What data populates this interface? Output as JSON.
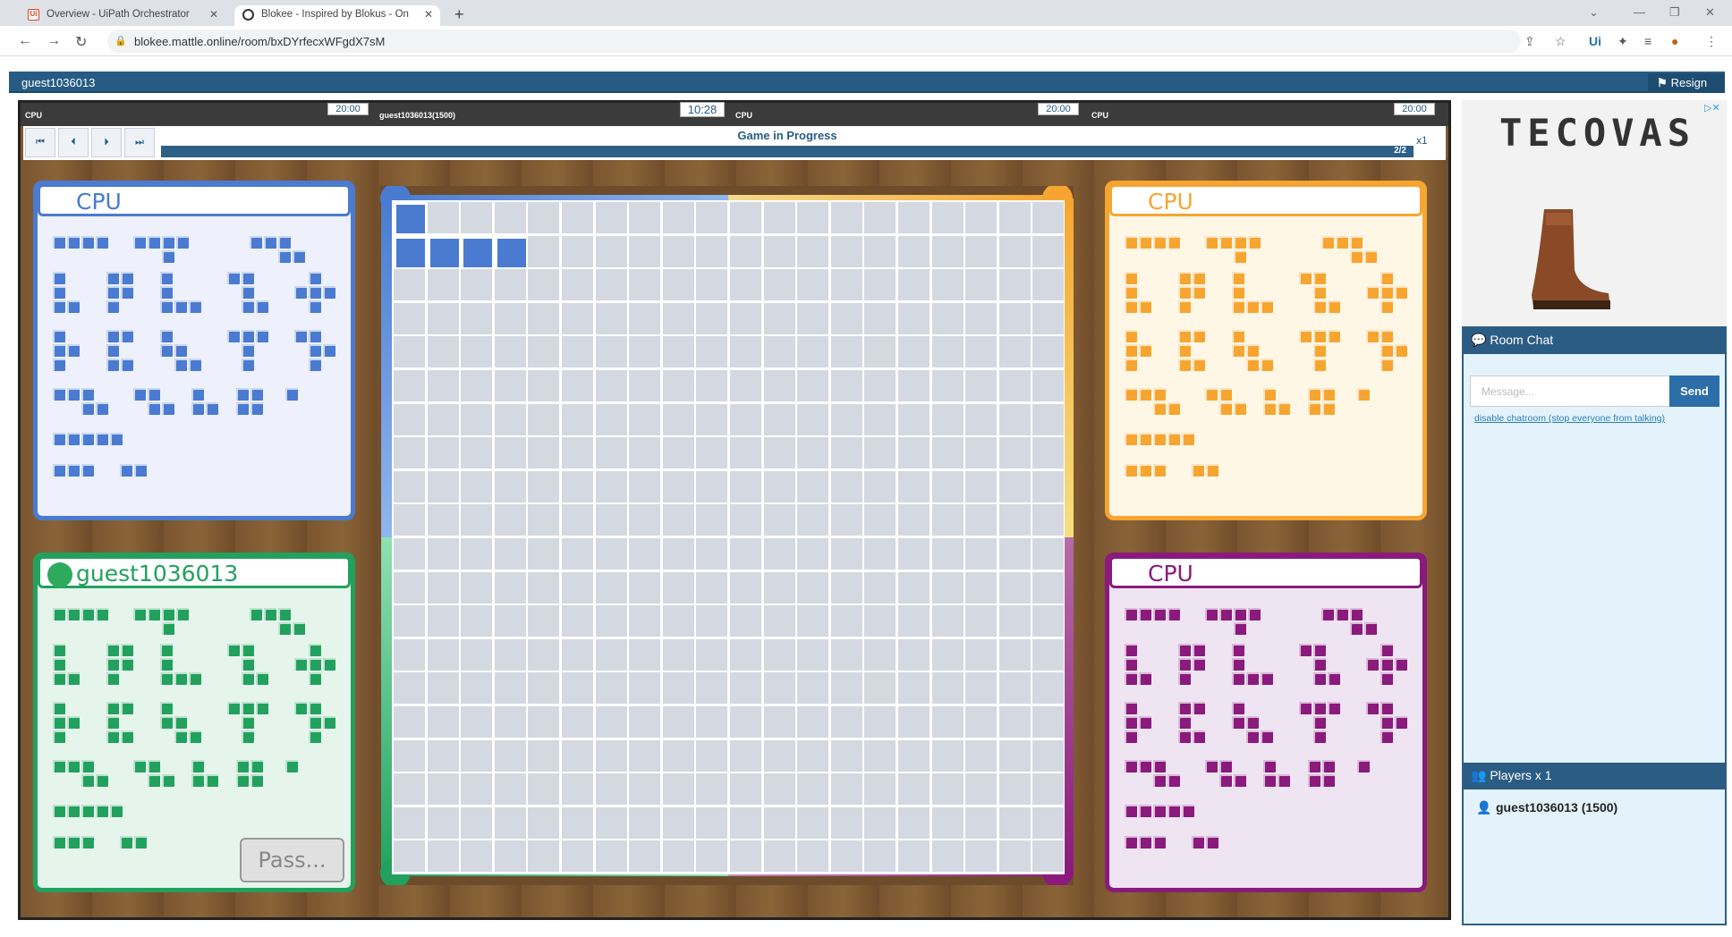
{
  "browser": {
    "tabs": [
      {
        "title": "Overview - UiPath Orchestrator",
        "icon": "uipath-icon"
      },
      {
        "title": "Blokee - Inspired by Blokus - On",
        "icon": "blokee-icon"
      }
    ],
    "url": "blokee.mattle.online/room/bxDYrfecxWFgdX7sM"
  },
  "header": {
    "username": "guest1036013",
    "resign_label": "Resign"
  },
  "timers": {
    "p1_name": "CPU",
    "p1_time": "20:00",
    "p2_name": "guest1036013(1500)",
    "current_time": "10:28",
    "p3_name": "CPU",
    "p3_time": "20:00",
    "p4_name": "CPU",
    "p4_time": "20:00"
  },
  "controls": {
    "status": "Game in Progress",
    "progress_label": "2/2",
    "progress_fraction": 1.0,
    "speed": "x1"
  },
  "panels": {
    "blue": {
      "name": "CPU",
      "color": "#4a7bd0"
    },
    "yellow": {
      "name": "CPU",
      "color": "#f7a531"
    },
    "green": {
      "name": "guest1036013",
      "color": "#22a15e"
    },
    "purple": {
      "name": "CPU",
      "color": "#8a1a7c"
    }
  },
  "pass_label": "Pass...",
  "ad": {
    "brand": "TECOVAS"
  },
  "chat": {
    "title": "Room Chat",
    "placeholder": "Message...",
    "send_label": "Send",
    "disable_link": "disable chatroom (stop everyone from talking)",
    "players_title": "Players x 1",
    "player": "guest1036013 (1500)"
  }
}
